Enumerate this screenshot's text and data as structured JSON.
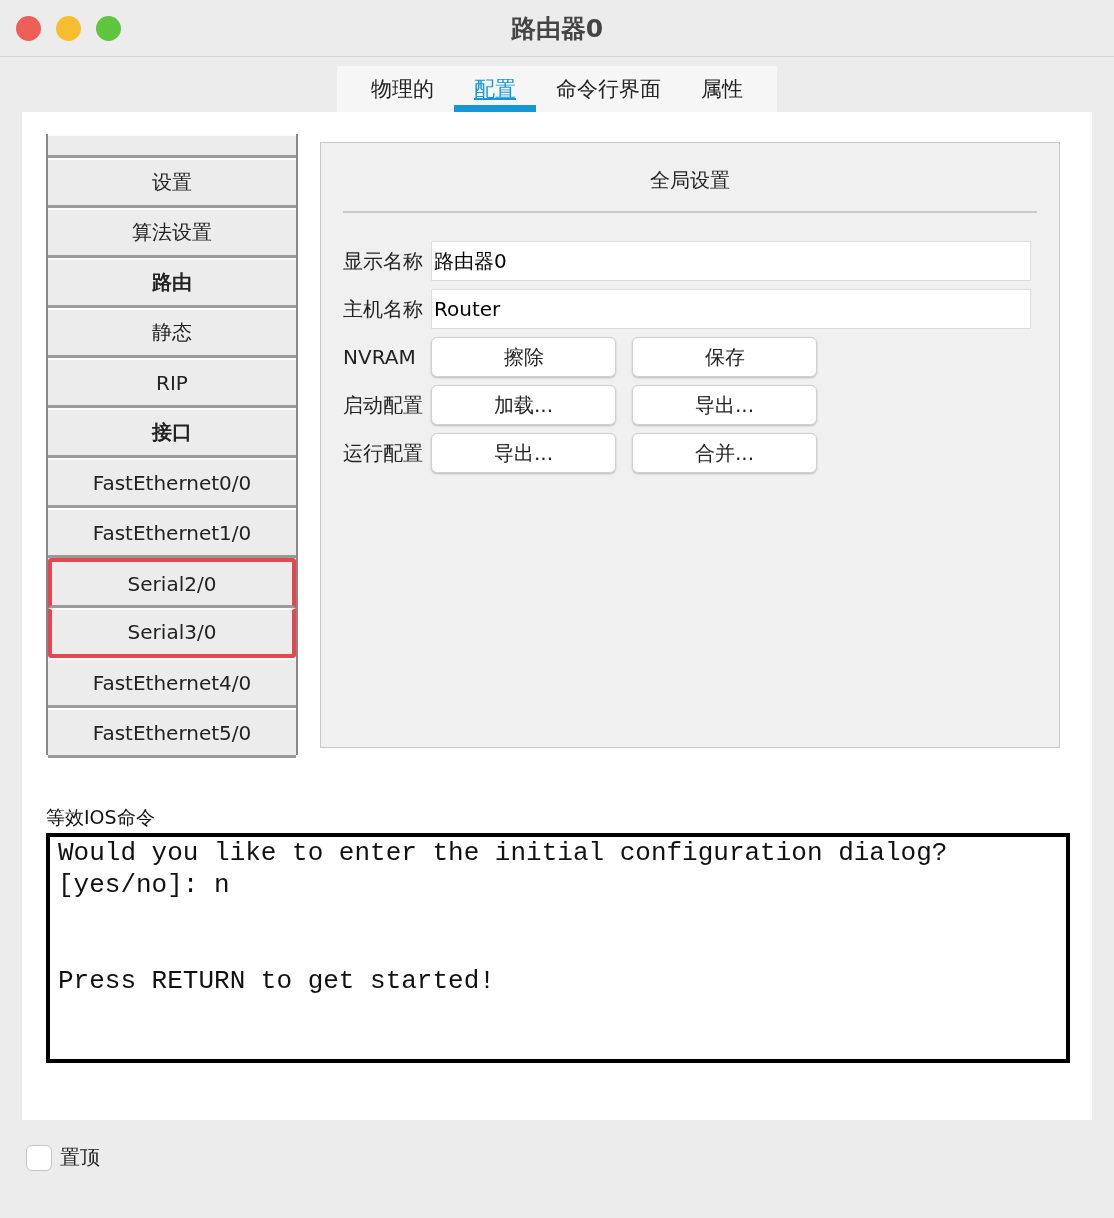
{
  "window": {
    "title": "路由器0"
  },
  "tabs": [
    {
      "label": "物理的",
      "selected": false
    },
    {
      "label": "配置",
      "selected": true
    },
    {
      "label": "命令行界面",
      "selected": false
    },
    {
      "label": "属性",
      "selected": false
    }
  ],
  "sidebar": {
    "items": [
      {
        "kind": "cut",
        "highlighted": false
      },
      {
        "label": "设置",
        "kind": "item",
        "highlighted": false
      },
      {
        "label": "算法设置",
        "kind": "item",
        "highlighted": false
      },
      {
        "label": "路由",
        "kind": "header",
        "highlighted": false
      },
      {
        "label": "静态",
        "kind": "item",
        "highlighted": false
      },
      {
        "label": "RIP",
        "kind": "item",
        "highlighted": false
      },
      {
        "label": "接口",
        "kind": "header",
        "highlighted": false
      },
      {
        "label": "FastEthernet0/0",
        "kind": "item",
        "highlighted": false
      },
      {
        "label": "FastEthernet1/0",
        "kind": "item",
        "highlighted": false
      },
      {
        "label": "Serial2/0",
        "kind": "item",
        "highlighted": true
      },
      {
        "label": "Serial3/0",
        "kind": "item",
        "highlighted": true
      },
      {
        "label": "FastEthernet4/0",
        "kind": "item",
        "highlighted": false
      },
      {
        "label": "FastEthernet5/0",
        "kind": "item",
        "highlighted": false
      }
    ]
  },
  "panel": {
    "title": "全局设置",
    "rows": [
      {
        "label": "显示名称",
        "kind": "field",
        "value": "路由器0"
      },
      {
        "label": "主机名称",
        "kind": "field",
        "value": "Router"
      },
      {
        "label": "NVRAM",
        "kind": "buttons",
        "buttons": [
          "擦除",
          "保存"
        ]
      },
      {
        "label": "启动配置",
        "kind": "buttons",
        "buttons": [
          "加载...",
          "导出..."
        ]
      },
      {
        "label": "运行配置",
        "kind": "buttons",
        "buttons": [
          "导出...",
          "合并..."
        ]
      }
    ]
  },
  "ios": {
    "label": "等效IOS命令",
    "blocks": [
      [
        "Would you like to enter the initial configuration dialog?",
        "[yes/no]: n"
      ],
      [
        "Press RETURN to get started!"
      ]
    ]
  },
  "footer": {
    "checkbox": {
      "label": "置顶",
      "checked": false
    }
  }
}
